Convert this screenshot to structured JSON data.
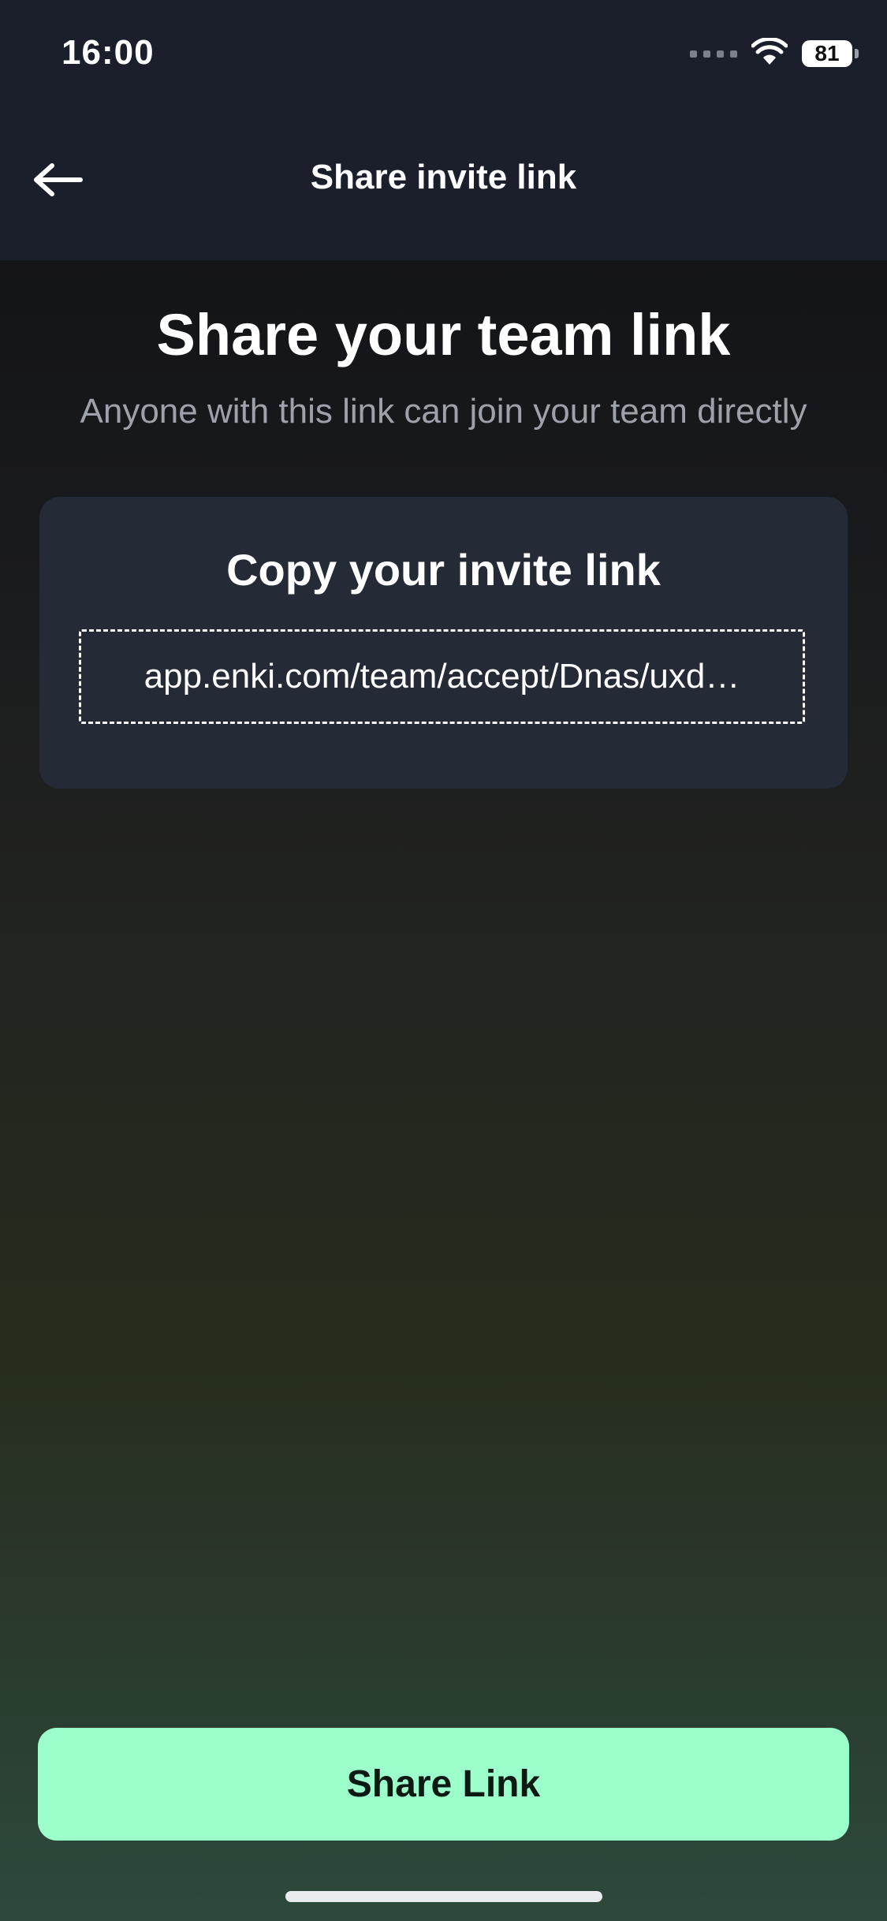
{
  "status_bar": {
    "time": "16:00",
    "battery": "81"
  },
  "app_bar": {
    "title": "Share invite link",
    "back_icon": "arrow-left-icon"
  },
  "content": {
    "heading": "Share your team link",
    "subheading": "Anyone with this link can join your team directly",
    "card": {
      "title": "Copy your invite link",
      "link": "app.enki.com/team/accept/Dnas/uxd…"
    }
  },
  "actions": {
    "share_label": "Share Link"
  },
  "colors": {
    "header_bg": "#1b1f2c",
    "card_bg": "#252a37",
    "accent": "#9cffcb"
  }
}
